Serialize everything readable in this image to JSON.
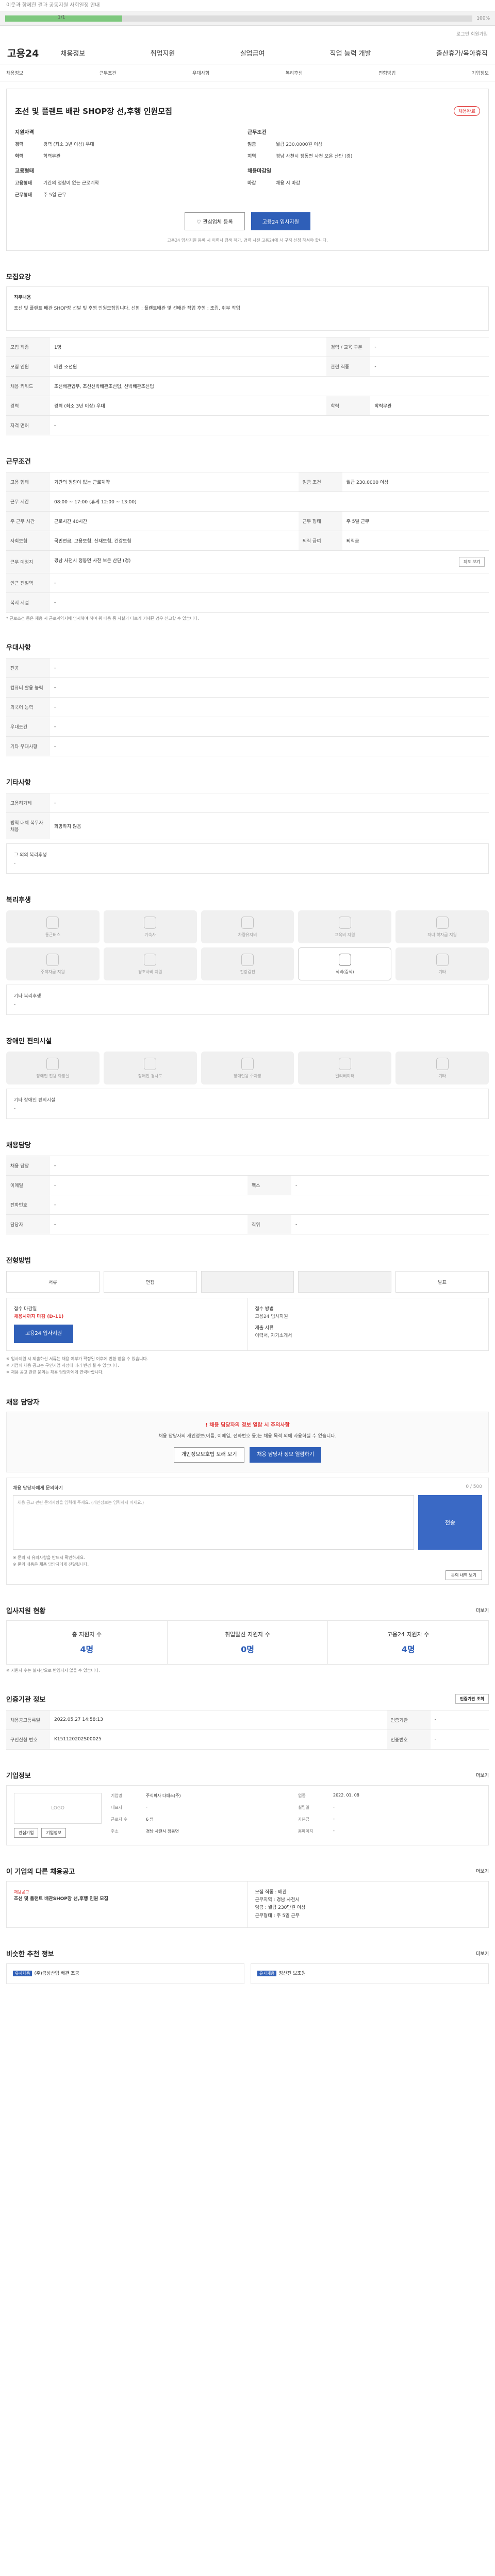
{
  "topnote": "이웃과 함께한 결과 공동지원 사회일정 안내",
  "progress": {
    "label": "1/1",
    "fraction": 0.25,
    "pct": "100%"
  },
  "util": "로그인 회원가입",
  "logo": "고용24",
  "gnav": [
    "채용정보",
    "취업지원",
    "실업급여",
    "직업 능력 개발",
    "출산휴가/육아휴직"
  ],
  "subnav": [
    "채용정보",
    "근무조건",
    "우대사항",
    "복리후생",
    "전형방법",
    "기업정보"
  ],
  "job": {
    "title": "조선 및 플랜트 배관 SHOP장 선,후행 인원모집",
    "badge": "채용완료",
    "left_head": "지원자격",
    "left": [
      [
        "경력",
        "경력 (최소 3년 이상) 우대"
      ],
      [
        "학력",
        "학력무관"
      ]
    ],
    "left_head2": "고용형태",
    "left2": [
      [
        "고용형태",
        "기간의 정함이 없는 근로계약"
      ],
      [
        "근무형태",
        "주 5일 근무"
      ]
    ],
    "right_head": "근무조건",
    "right": [
      [
        "임금",
        "월급 230,0000원 이상"
      ],
      [
        "지역",
        "경남 사천시 정동면 사천 보은 산단 (경)"
      ]
    ],
    "right_head2": "채용마감일",
    "right2": [
      [
        "마감",
        "채용 시 마감"
      ]
    ],
    "btn_like": "관심업체 등록",
    "btn_apply": "고용24 입사지원",
    "note": "고용24 입사지원 등록 시 이력서 검색 허가, 경력 사전 고용24에 서 구직 신청 하셔야 합니다."
  },
  "recruit": {
    "head": "모집요강",
    "desc_title": "직무내용",
    "desc": "조선 및 플랜트 배관 SHOP장 선발 및 후행 인원모집입니다. 선형 : 플랜트배관 및 선배관 작업 후행 : 조립, 취부 작업",
    "rows": [
      [
        "모집 직종",
        "1명",
        "경력 / 교육 구분",
        "-"
      ],
      [
        "모집 인원",
        "배관 조선원",
        "관련 직종",
        "-"
      ],
      [
        "채용 키워드",
        "조선배관업무, 조선선박배관조선업, 선박배관조선업",
        "",
        ""
      ],
      [
        "경력",
        "경력 (최소 3년 이상) 우대",
        "학력",
        "학력무관"
      ],
      [
        "자격 면허",
        "-",
        "",
        ""
      ]
    ]
  },
  "cond": {
    "head": "근무조건",
    "rows": [
      [
        "고용 형태",
        "기간의 정함이 없는 근로계약",
        "임금 조건",
        "월급 230,0000 이상"
      ],
      [
        "근무 시간",
        "08:00 ~ 17:00 (휴게 12:00 ~ 13:00)",
        "",
        ""
      ],
      [
        "주 근무 시간",
        "근로시간 40시간",
        "근무 형태",
        "주 5일 근무"
      ],
      [
        "사회보험",
        "국민연금, 고용보험, 산재보험, 건강보험",
        "퇴직 급여",
        "퇴직금"
      ],
      [
        "근무 예정지",
        "경남 사천시 정동면 사천 보은 산단 (경)",
        "",
        ""
      ],
      [
        "인근 전철역",
        "-",
        "",
        ""
      ],
      [
        "복지 시설",
        "-",
        "",
        ""
      ]
    ],
    "map_btn": "지도 보기",
    "note": "* 근로조건 등은 채용 시 근로계약서에 명시해야 하며 위 내용 중 사실과 다르게 기재된 경우 신고할 수 있습니다."
  },
  "pref": {
    "head": "우대사항",
    "rows": [
      [
        "전공",
        "-"
      ],
      [
        "컴퓨터 활용 능력",
        "-"
      ],
      [
        "외국어 능력",
        "-"
      ],
      [
        "우대조건",
        "-"
      ],
      [
        "기타 우대사항",
        "-"
      ]
    ]
  },
  "etc": {
    "head": "기타사항",
    "rows": [
      [
        "고용허가제",
        "-"
      ],
      [
        "병역 대체 복무자 채용",
        "희망하지 않음"
      ]
    ],
    "box_title": "그 외의 복리후생",
    "box": "-"
  },
  "welfare": {
    "head": "복리후생",
    "items": [
      "통근버스",
      "기숙사",
      "차량유지비",
      "교육비 지원",
      "자녀 학자금 지원",
      "주택자금 지원",
      "경조사비 지원",
      "건강검진",
      "식비(중식)",
      "기타"
    ],
    "active": 8,
    "box_title": "기타 복리후생",
    "box": "-"
  },
  "disabled": {
    "head": "장애인 편의시설",
    "items": [
      "장애인 전용 화장실",
      "장애인 경사로",
      "장애인용 주차장",
      "엘리베이터",
      "기타"
    ],
    "box_title": "기타 장애인 편의시설",
    "box": "-"
  },
  "contact": {
    "head": "채용담당",
    "rows": [
      [
        "채용 담당",
        "-",
        "",
        ""
      ],
      [
        "이메일",
        "-",
        "팩스",
        "-"
      ],
      [
        "전화번호",
        "-",
        "",
        ""
      ],
      [
        "담당자",
        "-",
        "직위",
        "-"
      ]
    ]
  },
  "process": {
    "head": "전형방법",
    "steps": [
      "서류",
      "면접",
      "",
      "",
      "발표"
    ],
    "apply_title": "접수 마감일",
    "apply": "채용시까지 마감",
    "apply_sub": "(D-11)",
    "apply_btn": "고용24 입사지원",
    "docs_title": "접수 방법",
    "docs": "고용24 입사지원",
    "docs2_title": "제출 서류",
    "docs2": "이력서, 자기소개서"
  },
  "notes": [
    "※ 입사지원 시 제출하신 서류는 채용 여부가 확정된 이후에 반환 받을 수 있습니다.",
    "※ 기업의 채용 공고는 구인기업 사정에 따라 변경 될 수 있습니다.",
    "※ 채용 공고 관련 문의는 채용 담당자에게 연락바랍니다."
  ],
  "alert": {
    "head": "채용 담당자",
    "title": "! 채용 담당자의 정보 열람 시 주의사항",
    "body": "채용 담당자의 개인정보(이름, 이메일, 전화번호 등)는 채용 목적 외에 사용하실 수 없습니다.",
    "btn1": "개인정보보호법 보러 보기",
    "btn2": "채용 담당자 정보 열람하기"
  },
  "inq": {
    "title": "채용 담당자에게 문의하기",
    "count": "0 / 500",
    "placeholder": "채용 공고 관련 문의사항을 입력해 주세요. (개인정보는 입력하지 마세요.)",
    "submit": "전송",
    "btn": "문의 내역 보기",
    "notes": [
      "※ 문의 시 유의사항을 반드시 확인하세요.",
      "※ 문의 내용은 채용 담당자에게 전달됩니다."
    ]
  },
  "stats": {
    "head": "입사지원 현황",
    "more": "더보기",
    "items": [
      [
        "총 지원자 수",
        "4명"
      ],
      [
        "취업알선 지원자 수",
        "0명"
      ],
      [
        "고용24 지원자 수",
        "4명"
      ]
    ],
    "note": "※ 지원자 수는 실시간으로 반영되지 않을 수 있습니다."
  },
  "period": {
    "head": "인증기관 정보",
    "btn": "인증기관 조회",
    "rows": [
      [
        "채용공고등록일",
        "2022.05.27 14:58:13",
        "인증기관",
        "-"
      ],
      [
        "구인신청 번호",
        "K151120202S00025",
        "인증번호",
        "-"
      ]
    ]
  },
  "company": {
    "head": "기업정보",
    "more": "더보기",
    "logo": "LOGO",
    "b1": "관심기업",
    "b2": "기업정보",
    "rows": [
      [
        "기업명",
        "주식회사 다패스(주)",
        "업종",
        "2022. 01. 08"
      ],
      [
        "대표자",
        "-",
        "설립일",
        "-"
      ],
      [
        "근로자 수",
        "6 명",
        "자본금",
        "-"
      ],
      [
        "주소",
        "경남 사천시 정동면",
        "홈페이지",
        "-"
      ]
    ]
  },
  "related": {
    "head": "이 기업의 다른 채용공고",
    "more": "더보기",
    "left_title": "채용공고",
    "left": "조선 및 플랜트 배관SHOP장 선,후행 인원 모집",
    "right": [
      "모집 직종 : 배관",
      "근무지역 : 경남 사천시",
      "임금 : 월급 230만원 이상",
      "근무형태 : 주 5일 근무"
    ]
  },
  "similar": {
    "head": "비슷한 추천 정보",
    "more": "더보기",
    "items": [
      [
        "유사채용",
        "(주)금성산업 배관 조공"
      ],
      [
        "유사채용",
        "정산전 보조원"
      ]
    ]
  }
}
